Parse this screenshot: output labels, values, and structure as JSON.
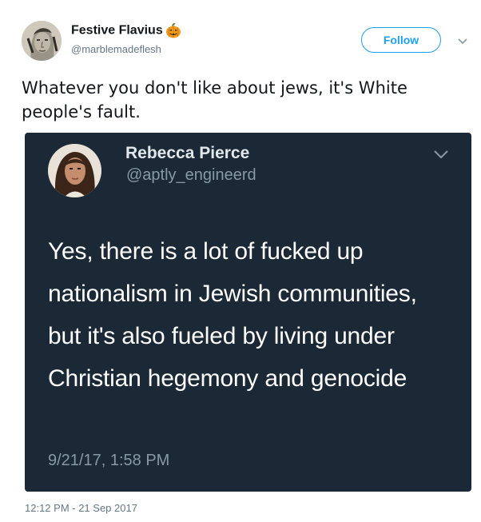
{
  "tweet": {
    "author": {
      "display_name": "Festive Flavius",
      "handle": "@marblemadeflesh",
      "name_emoji": "pumpkin-icon"
    },
    "follow_label": "Follow",
    "text": "Whatever you don't like about jews, it's White people's fault.",
    "timestamp": "12:12 PM - 21 Sep 2017"
  },
  "embedded_tweet": {
    "author": {
      "display_name": "Rebecca Pierce",
      "handle": "@aptly_engineerd"
    },
    "text": "Yes, there is a lot of fucked up nationalism in Jewish communities, but it's also fueled by living under Christian hegemony and genocide",
    "time": "9/21/17, 1:58 PM"
  },
  "colors": {
    "accent": "#1da1f2",
    "secondary_text": "#657786",
    "embed_background": "#1b2836",
    "embed_secondary_text": "#8899a6"
  }
}
